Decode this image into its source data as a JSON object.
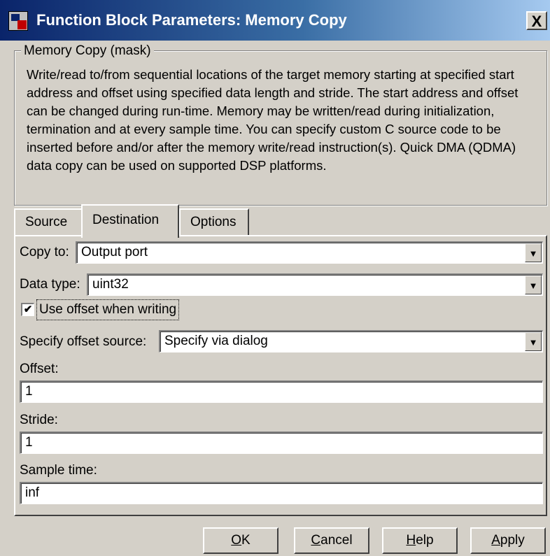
{
  "window": {
    "title": "Function Block Parameters: Memory Copy",
    "close_label": "X"
  },
  "mask": {
    "legend": "Memory Copy (mask)",
    "description": "Write/read to/from sequential locations of the target memory starting at specified start address and offset using specified data length and stride. The start address and offset can be changed during run-time. Memory may be written/read during initialization, termination and at every sample time. You can specify custom C source code to be inserted before and/or after the memory write/read instruction(s). Quick DMA (QDMA) data copy can be used on supported DSP platforms."
  },
  "tabs": [
    {
      "label": "Source",
      "active": false
    },
    {
      "label": "Destination",
      "active": true
    },
    {
      "label": "Options",
      "active": false
    }
  ],
  "form": {
    "copy_to": {
      "label": "Copy to:",
      "value": "Output port"
    },
    "data_type": {
      "label": "Data type:",
      "value": "uint32"
    },
    "use_offset": {
      "label": "Use offset when writing",
      "checked": true,
      "mark": "✔"
    },
    "offset_source": {
      "label": "Specify offset source:",
      "value": "Specify via dialog"
    },
    "offset": {
      "label": "Offset:",
      "value": "1"
    },
    "stride": {
      "label": "Stride:",
      "value": "1"
    },
    "sample_time": {
      "label": "Sample time:",
      "value": "inf"
    }
  },
  "buttons": {
    "ok": {
      "mnemonic": "O",
      "rest": "K"
    },
    "cancel": {
      "mnemonic": "C",
      "rest": "ancel"
    },
    "help": {
      "mnemonic": "H",
      "rest": "elp"
    },
    "apply": {
      "mnemonic": "A",
      "rest": "pply"
    }
  },
  "icons": {
    "dropdown": "chevron-down-icon",
    "app": "simulink-block-icon"
  }
}
